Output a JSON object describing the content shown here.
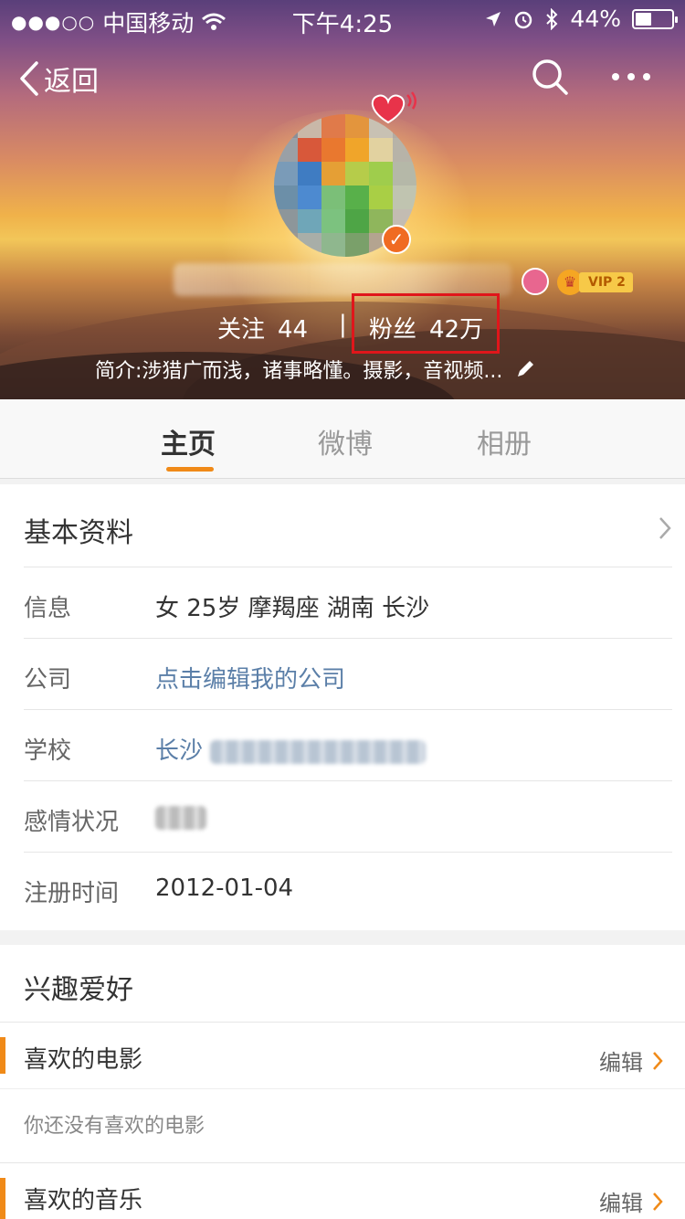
{
  "status_bar": {
    "carrier": "中国移动",
    "time": "下午4:25",
    "battery": "44%",
    "battery_level": 0.44
  },
  "nav": {
    "back_label": "返回"
  },
  "profile": {
    "follow_label": "关注",
    "follow_count": "44",
    "separator": "|",
    "fans_label": "粉丝",
    "fans_count": "42万",
    "vip_label": "VIP 2",
    "intro": "简介:涉猎广而浅，诸事略懂。摄影，音视频..."
  },
  "tabs": [
    {
      "label": "主页",
      "active": true
    },
    {
      "label": "微博",
      "active": false
    },
    {
      "label": "相册",
      "active": false
    }
  ],
  "basic_info": {
    "title": "基本资料",
    "rows": [
      {
        "label": "信息",
        "value": "女  25岁  摩羯座  湖南 长沙"
      },
      {
        "label": "公司",
        "value": "点击编辑我的公司"
      },
      {
        "label": "学校",
        "value": "长沙"
      },
      {
        "label": "感情状况",
        "value": ""
      },
      {
        "label": "注册时间",
        "value": "2012-01-04"
      }
    ]
  },
  "hobbies": {
    "title": "兴趣爱好",
    "movie_label": "喜欢的电影",
    "movie_empty": "你还没有喜欢的电影",
    "music_label": "喜欢的音乐",
    "edit_label": "编辑"
  },
  "colors": {
    "accent": "#f08a18",
    "link": "#5b7fa8",
    "highlight_box": "#e0161b"
  }
}
